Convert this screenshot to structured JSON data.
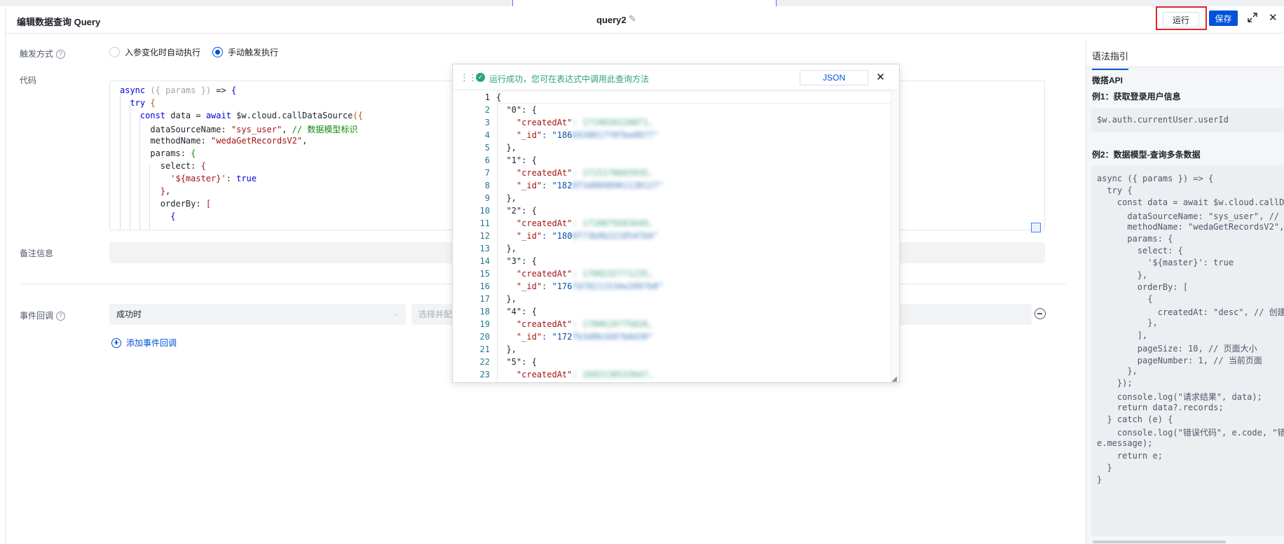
{
  "header": {
    "title": "编辑数据查询 Query",
    "query_name": "query2",
    "run_label": "运行",
    "save_label": "保存"
  },
  "form": {
    "trigger_label": "触发方式",
    "trigger_options": [
      "入参变化时自动执行",
      "手动触发执行"
    ],
    "trigger_selected": "手动触发执行",
    "code_label": "代码",
    "code_lines": [
      "async ({ params }) => {",
      "  try {",
      "    const data = await $w.cloud.callDataSource({",
      "      dataSourceName: \"sys_user\", // 数据模型标识",
      "      methodName: \"wedaGetRecordsV2\",",
      "      params: {",
      "        select: {",
      "          '${master}': true",
      "        },",
      "        orderBy: [",
      "          {"
    ],
    "remark_label": "备注信息",
    "event_label": "事件回调",
    "event_when": "成功时",
    "event_action_placeholder": "选择并配置",
    "add_event_label": "添加事件回调"
  },
  "result_popup": {
    "status_message": "运行成功，您可在表达式中调用此查询方法",
    "json_button": "JSON",
    "line_numbers": [
      "1",
      "2",
      "3",
      "4",
      "5",
      "6",
      "7",
      "8",
      "9",
      "10",
      "11",
      "12",
      "13",
      "14",
      "15",
      "16",
      "17",
      "18",
      "19",
      "20",
      "21",
      "22",
      "23"
    ],
    "lines": [
      {
        "text": "{"
      },
      {
        "text": "  \"0\": {"
      },
      {
        "key": "    \"createdAt\"",
        "rest": ": 1719039220871,"
      },
      {
        "key": "    \"_id\"",
        "prefix": ": \"186",
        "rest": "6938817f8fbe0877\""
      },
      {
        "text": "  },"
      },
      {
        "text": "  \"1\": {"
      },
      {
        "key": "    \"createdAt\"",
        "rest": ": 1715178665935,"
      },
      {
        "key": "    \"_id\"",
        "prefix": ": \"182",
        "rest": "8f3d8898901138127\""
      },
      {
        "text": "  },"
      },
      {
        "text": "  \"2\": {"
      },
      {
        "key": "    \"createdAt\"",
        "rest": ": 1710879583649,"
      },
      {
        "key": "    \"_id\"",
        "prefix": ": \"180",
        "rest": "0f73b9b2218547b9\""
      },
      {
        "text": "  },"
      },
      {
        "text": "  \"3\": {"
      },
      {
        "key": "    \"createdAt\"",
        "rest": ": 1708232771235,"
      },
      {
        "key": "    \"_id\"",
        "prefix": ": \"176",
        "rest": "fd78211534e2897b0\""
      },
      {
        "text": "  },"
      },
      {
        "text": "  \"4\": {"
      },
      {
        "key": "    \"createdAt\"",
        "rest": ": 1700619775026,"
      },
      {
        "key": "    \"_id\"",
        "prefix": ": \"172",
        "rest": "fb3d9b1607b8d30\""
      },
      {
        "text": "  },"
      },
      {
        "text": "  \"5\": {"
      },
      {
        "key": "    \"createdAt\"",
        "rest": ": 1692130533647,"
      }
    ]
  },
  "right_panel": {
    "tab": "语法指引",
    "section": "微搭API",
    "example1_title": "例1：获取登录用户信息",
    "example1_code": "$w.auth.currentUser.userId",
    "example2_title": "例2：数据模型-查询多条数据",
    "example2_lines": [
      "async ({ params }) => {",
      "  try {",
      "    const data = await $w.cloud.callDa",
      "      dataSourceName: \"sys_user\", // 数",
      "      methodName: \"wedaGetRecordsV2\",",
      "      params: {",
      "        select: {",
      "          '${master}': true",
      "        },",
      "        orderBy: [",
      "          {",
      "            createdAt: \"desc\", // 创建时",
      "          },",
      "        ],",
      "        pageSize: 10, // 页面大小",
      "        pageNumber: 1, // 当前页面",
      "      },",
      "    });",
      "    console.log(\"请求结果\", data);",
      "    return data?.records;",
      "  } catch (e) {",
      "    console.log(\"错误代码\", e.code, \"错误",
      "e.message);",
      "    return e;",
      "  }",
      "}"
    ]
  },
  "icons": [
    "edit-pencil-icon",
    "expand-icon",
    "close-icon",
    "help-icon",
    "drag-handle-icon",
    "success-check-icon",
    "fullscreen-icon",
    "remove-icon",
    "add-icon"
  ]
}
